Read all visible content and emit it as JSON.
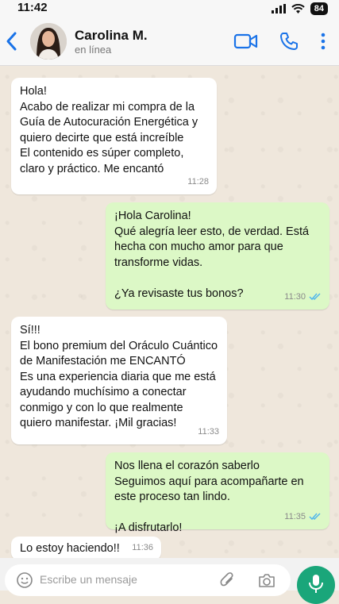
{
  "status_bar": {
    "time": "11:42",
    "battery": "84"
  },
  "header": {
    "contact_name": "Carolina M.",
    "contact_status": "en línea"
  },
  "messages": [
    {
      "direction": "in",
      "text": "Hola!\nAcabo de realizar mi compra de la\nGuía de Autocuración Energética y\nquiero decirte que está increíble\nEl contenido es súper completo,\nclaro y práctico. Me encantó",
      "time": "11:28"
    },
    {
      "direction": "out",
      "text": "¡Hola Carolina!\nQué alegría leer esto, de verdad. Está\nhecha con mucho amor para que\ntransforme vidas.\n\n¿Ya revisaste tus bonos?",
      "time": "11:30",
      "read": true
    },
    {
      "direction": "in",
      "text": "Sí!!!\nEl bono premium del Oráculo Cuántico\nde Manifestación me ENCANTÓ\nEs una experiencia diaria que me está\nayudando muchísimo a conectar\nconmigo y con lo que realmente\nquiero manifestar. ¡Mil gracias!",
      "time": "11:33"
    },
    {
      "direction": "out",
      "text": "Nos llena el corazón saberlo\nSeguimos aquí para acompañarte en\neste proceso tan lindo.\n\n¡A disfrutarlo!",
      "time": "11:35",
      "read": true
    },
    {
      "direction": "in",
      "text": "Lo estoy haciendo!!",
      "time": "11:36"
    }
  ],
  "composer": {
    "placeholder": "Escribe un mensaje"
  },
  "colors": {
    "accent": "#1a73e8",
    "outgoing_bubble": "#dcf8c6",
    "mic_button": "#1aa67a",
    "read_ticks": "#4fb6ec"
  }
}
